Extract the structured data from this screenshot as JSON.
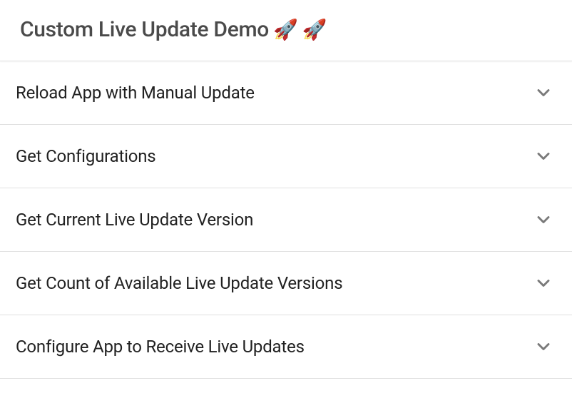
{
  "header": {
    "title": "Custom Live Update Demo",
    "icons": [
      "🚀",
      "🚀"
    ]
  },
  "items": [
    {
      "label": "Reload App with Manual Update"
    },
    {
      "label": "Get Configurations"
    },
    {
      "label": "Get Current Live Update Version"
    },
    {
      "label": "Get Count of Available Live Update Versions"
    },
    {
      "label": "Configure App to Receive Live Updates"
    }
  ]
}
